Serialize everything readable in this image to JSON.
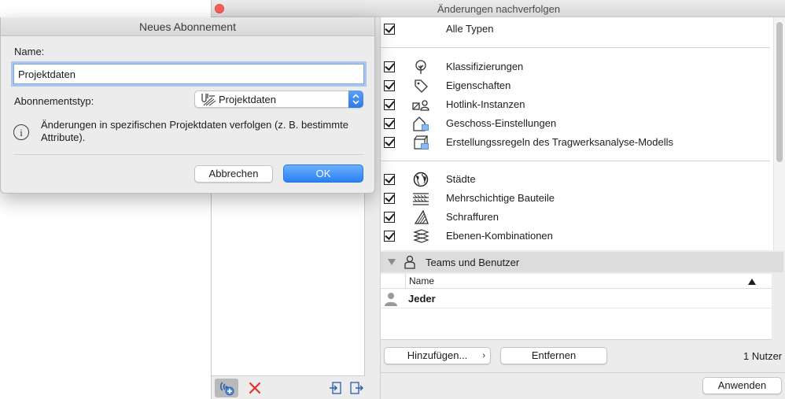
{
  "window": {
    "title": "Änderungen nachverfolgen"
  },
  "types": {
    "items": [
      {
        "label": "Alle Typen",
        "checked": true,
        "icon": "none"
      },
      {
        "label": "Klassifizierungen",
        "checked": true,
        "icon": "tree-icon"
      },
      {
        "label": "Eigenschaften",
        "checked": true,
        "icon": "tag-icon"
      },
      {
        "label": "Hotlink-Instanzen",
        "checked": true,
        "icon": "hotlink-icon"
      },
      {
        "label": "Geschoss-Einstellungen",
        "checked": true,
        "icon": "building-icon"
      },
      {
        "label": "Erstellungssregeln des Tragwerksanalyse-Modells",
        "checked": true,
        "icon": "structural-model-icon"
      },
      {
        "label": "Städte",
        "checked": true,
        "icon": "globe-icon"
      },
      {
        "label": "Mehrschichtige Bauteile",
        "checked": true,
        "icon": "layers-icon"
      },
      {
        "label": "Schraffuren",
        "checked": true,
        "icon": "hatch-icon"
      },
      {
        "label": "Ebenen-Kombinationen",
        "checked": true,
        "icon": "layer-combo-icon"
      }
    ]
  },
  "teams": {
    "header": "Teams und Benutzer",
    "column_name": "Name",
    "users": [
      {
        "name": "Jeder",
        "icon": "person-icon"
      }
    ],
    "add_button": "Hinzufügen...",
    "add_arrow": "›",
    "remove_button": "Entfernen",
    "user_count": "1 Nutzer",
    "apply_button": "Anwenden"
  },
  "dialog": {
    "title": "Neues Abonnement",
    "name_label": "Name:",
    "name_value": "Projektdaten",
    "type_label": "Abonnementstyp:",
    "type_value": "Projektdaten",
    "info_text": "Änderungen in spezifischen Projektdaten verfolgen (z. B. bestimmte Attribute).",
    "info_glyph": "i",
    "cancel_button": "Abbrechen",
    "ok_button": "OK"
  },
  "colors": {
    "accent": "#2b7ff0",
    "close": "#fc5f57",
    "remove": "#e0352b"
  }
}
